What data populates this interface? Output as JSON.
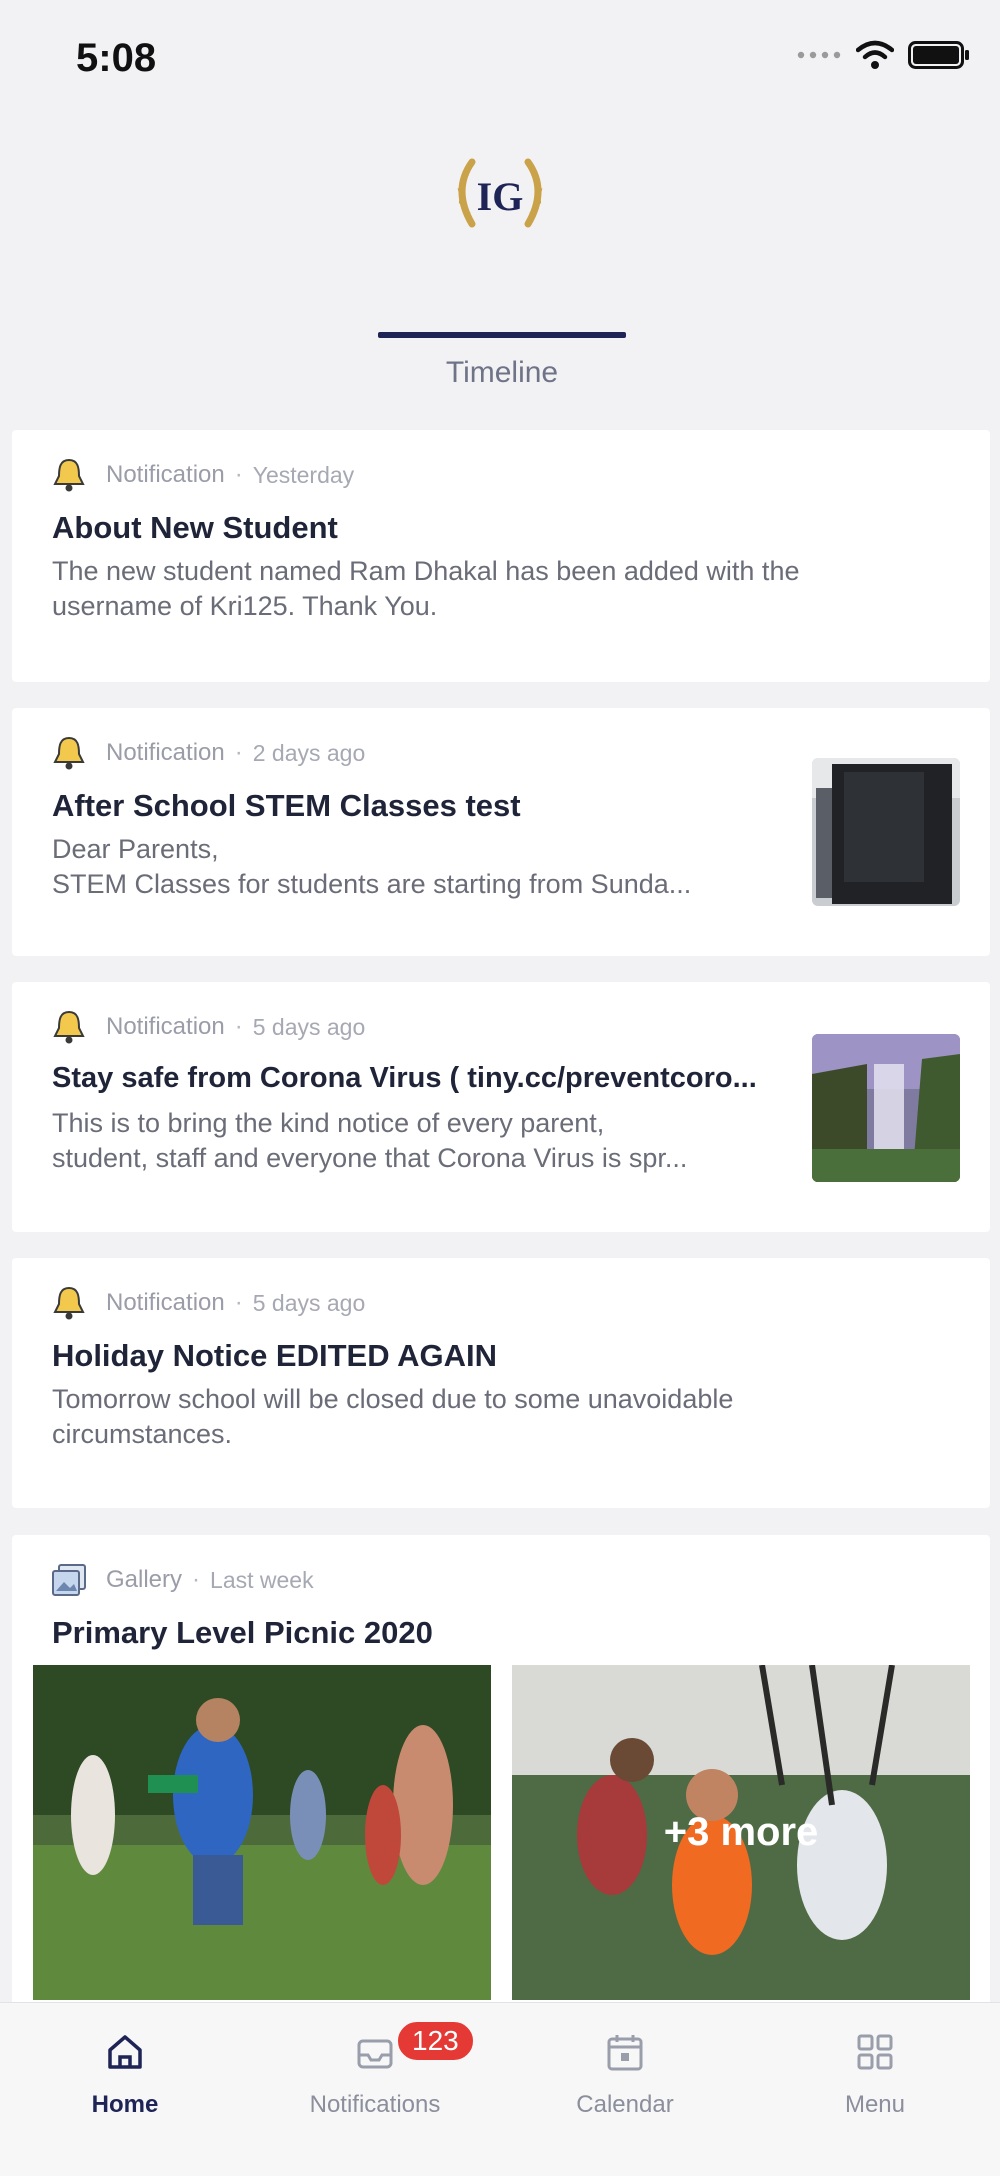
{
  "status_bar": {
    "time": "5:08"
  },
  "logo": {
    "text": "IG"
  },
  "tabs": [
    {
      "label": "Timeline",
      "active": true
    }
  ],
  "feed": [
    {
      "type": "Notification",
      "time": "Yesterday",
      "title": "About New Student",
      "body": [
        "The new student named Ram Dhakal has been added with the",
        "username of Kri125. Thank You."
      ]
    },
    {
      "type": "Notification",
      "time": "2 days ago",
      "title": "After School STEM Classes test",
      "body": [
        "Dear Parents,",
        "STEM Classes for students are starting from Sunda..."
      ]
    },
    {
      "type": "Notification",
      "time": "5 days ago",
      "title": "Stay safe from Corona Virus ( tiny.cc/preventcoro...",
      "body": [
        "This is to bring the kind notice of every parent,",
        "student, staff and everyone that Corona Virus is spr..."
      ]
    },
    {
      "type": "Notification",
      "time": "5 days ago",
      "title": "Holiday Notice EDITED AGAIN",
      "body": [
        "Tomorrow school will be closed due to some unavoidable",
        "circumstances."
      ]
    },
    {
      "type": "Gallery",
      "time": "Last week",
      "title": "Primary Level Picnic 2020",
      "more_label": "+3 more"
    }
  ],
  "bottom_nav": [
    {
      "label": "Home",
      "icon": "home-icon",
      "active": true
    },
    {
      "label": "Notifications",
      "icon": "notification-tray-icon",
      "badge": "123"
    },
    {
      "label": "Calendar",
      "icon": "calendar-icon"
    },
    {
      "label": "Menu",
      "icon": "grid-menu-icon"
    }
  ],
  "colors": {
    "accent": "#1f2457",
    "badge": "#e53935",
    "logo_gold": "#c9a24a"
  }
}
